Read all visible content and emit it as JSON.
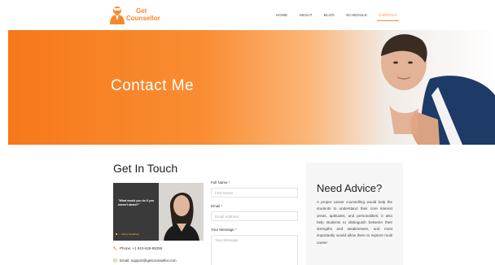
{
  "brand": {
    "line1": "Get",
    "line2": "Counsellor",
    "color": "#f7892b"
  },
  "nav": {
    "items": [
      {
        "label": "HOME",
        "active": false
      },
      {
        "label": "ABOUT",
        "active": false
      },
      {
        "label": "BLOG",
        "active": false
      },
      {
        "label": "SCHEDULE",
        "active": false
      },
      {
        "label": "CONTACT",
        "active": true
      }
    ]
  },
  "hero": {
    "title": "Contact Me"
  },
  "get_in_touch": {
    "title": "Get In Touch",
    "card": {
      "quote": "\"What would you do if you weren't afraid?\"",
      "signature": "— Sheryl Sandberg"
    },
    "phone": "Phone: +1 910-626-85255",
    "email": "Email: support@getcounsellor.com"
  },
  "form": {
    "full_name": {
      "label": "Full Name",
      "required_mark": "*",
      "placeholder": "First Name"
    },
    "email": {
      "label": "Email",
      "required_mark": "*",
      "placeholder": "Email Address"
    },
    "message": {
      "label": "Your Message",
      "required_mark": "*",
      "placeholder": "Your Message"
    }
  },
  "advice": {
    "title": "Need Advice?",
    "body": "A proper career counselling would help the students to understand their core interest areas, aptitudes, and personalities; it also help students to distinguish between their strengths and weaknesses, and most importantly would allow them to explore multi career"
  },
  "colors": {
    "accent": "#f7892b",
    "hero_start": "#f7781a",
    "required": "#e0332f"
  },
  "icons": {
    "phone": "phone-icon",
    "email": "mail-icon"
  }
}
